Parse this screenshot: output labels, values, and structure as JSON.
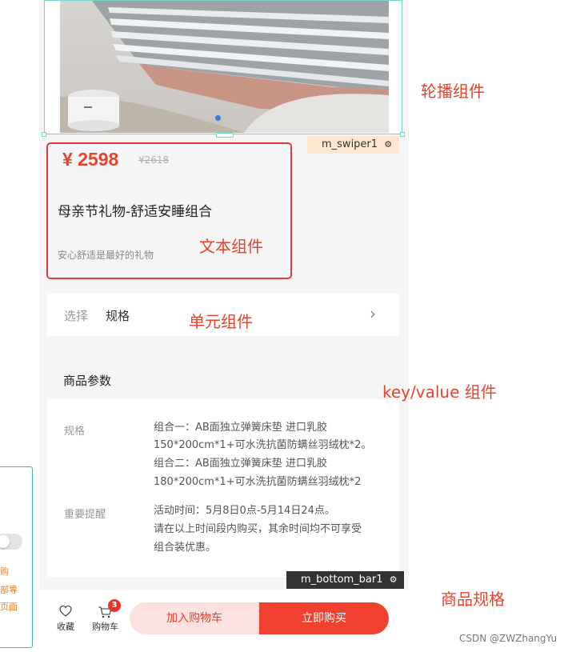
{
  "left_panel": {
    "lines": [
      "购",
      "部导",
      "页面"
    ]
  },
  "swiper": {
    "tag_label": "m_swiper1"
  },
  "product": {
    "price": "¥ 2598",
    "original_price": "¥2618",
    "title": "母亲节礼物-舒适安睡组合",
    "subtitle": "安心舒适是最好的礼物"
  },
  "cell": {
    "label": "选择",
    "value": "规格",
    "arrow": "›"
  },
  "params": {
    "title": "商品参数",
    "rows": [
      {
        "key": "规格",
        "lines": [
          "组合一：AB面独立弹簧床垫 进口乳胶",
          "150*200cm*1+可水洗抗菌防螨丝羽绒枕*2。",
          "组合二：AB面独立弹簧床垫 进口乳胶",
          "180*200cm*1+可水洗抗菌防螨丝羽绒枕*2"
        ]
      },
      {
        "key": "重要提醒",
        "lines": [
          "活动时间：5月8日0点-5月14日24点。",
          "请在以上时间段内购买，其余时间均不可享受",
          "组合装优惠。"
        ]
      }
    ]
  },
  "bottom_bar": {
    "tag_label": "m_bottom_bar1",
    "favorite_label": "收藏",
    "cart_label": "购物车",
    "cart_count": "3",
    "add_to_cart_label": "加入购物车",
    "buy_now_label": "立即购买"
  },
  "annotations": {
    "swiper": "轮播组件",
    "text": "文本组件",
    "cell": "单元组件",
    "kv": "key/value 组件",
    "spec": "商品规格"
  },
  "credit": "CSDN @ZWZhangYu",
  "colors": {
    "accent_red": "#e8422d",
    "buy_button": "#f0402f",
    "cart_button": "#fde0e0",
    "selection_teal": "#6fd7c9"
  }
}
